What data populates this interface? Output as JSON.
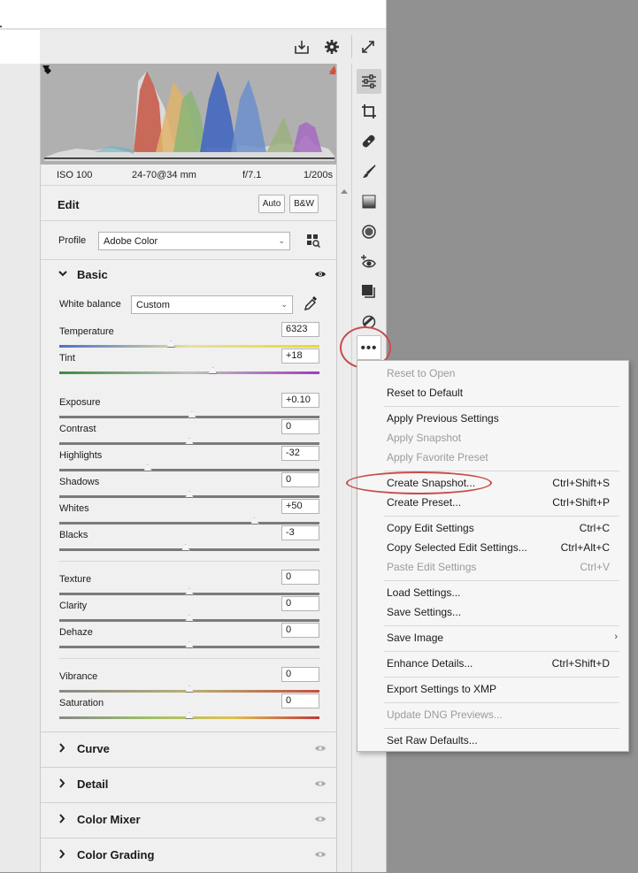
{
  "camera_info": {
    "iso": "ISO 100",
    "lens": "24-70@34 mm",
    "aperture": "f/7.1",
    "shutter": "1/200s"
  },
  "edit": {
    "title": "Edit",
    "auto_label": "Auto",
    "bw_label": "B&W"
  },
  "profile": {
    "label": "Profile",
    "value": "Adobe Color"
  },
  "basic": {
    "title": "Basic",
    "white_balance": {
      "label": "White balance",
      "value": "Custom"
    },
    "sliders": [
      {
        "label": "Temperature",
        "value": "6323",
        "position": 0.43
      },
      {
        "label": "Tint",
        "value": "+18",
        "position": 0.59
      },
      {
        "label": "Exposure",
        "value": "+0.10",
        "position": 0.51
      },
      {
        "label": "Contrast",
        "value": "0",
        "position": 0.5
      },
      {
        "label": "Highlights",
        "value": "-32",
        "position": 0.34
      },
      {
        "label": "Shadows",
        "value": "0",
        "position": 0.5
      },
      {
        "label": "Whites",
        "value": "+50",
        "position": 0.75
      },
      {
        "label": "Blacks",
        "value": "-3",
        "position": 0.485
      },
      {
        "label": "Texture",
        "value": "0",
        "position": 0.5
      },
      {
        "label": "Clarity",
        "value": "0",
        "position": 0.5
      },
      {
        "label": "Dehaze",
        "value": "0",
        "position": 0.5
      },
      {
        "label": "Vibrance",
        "value": "0",
        "position": 0.5
      },
      {
        "label": "Saturation",
        "value": "0",
        "position": 0.5
      }
    ]
  },
  "collapsed_sections": [
    "Curve",
    "Detail",
    "Color Mixer",
    "Color Grading"
  ],
  "more_button": {
    "label": "•••"
  },
  "menu": {
    "items": [
      {
        "label": "Reset to Open",
        "shortcut": "",
        "disabled": true
      },
      {
        "label": "Reset to Default",
        "shortcut": "",
        "disabled": false
      },
      {
        "label": "Apply Previous Settings",
        "shortcut": "",
        "disabled": false
      },
      {
        "label": "Apply Snapshot",
        "shortcut": "",
        "disabled": true
      },
      {
        "label": "Apply Favorite Preset",
        "shortcut": "",
        "disabled": true
      },
      {
        "label": "Create Snapshot...",
        "shortcut": "Ctrl+Shift+S",
        "disabled": false
      },
      {
        "label": "Create Preset...",
        "shortcut": "Ctrl+Shift+P",
        "disabled": false
      },
      {
        "label": "Copy Edit Settings",
        "shortcut": "Ctrl+C",
        "disabled": false
      },
      {
        "label": "Copy Selected Edit Settings...",
        "shortcut": "Ctrl+Alt+C",
        "disabled": false
      },
      {
        "label": "Paste Edit Settings",
        "shortcut": "Ctrl+V",
        "disabled": true
      },
      {
        "label": "Load Settings...",
        "shortcut": "",
        "disabled": false
      },
      {
        "label": "Save Settings...",
        "shortcut": "",
        "disabled": false
      },
      {
        "label": "Save Image",
        "shortcut": "",
        "disabled": false
      },
      {
        "label": "Enhance Details...",
        "shortcut": "Ctrl+Shift+D",
        "disabled": false
      },
      {
        "label": "Export Settings to XMP",
        "shortcut": "",
        "disabled": false
      },
      {
        "label": "Update DNG Previews...",
        "shortcut": "",
        "disabled": true
      },
      {
        "label": "Set Raw Defaults...",
        "shortcut": "",
        "disabled": false
      }
    ]
  },
  "colors": {
    "annotation_red": "#c84c4c",
    "histogram_bg": "#b0b0b0"
  }
}
